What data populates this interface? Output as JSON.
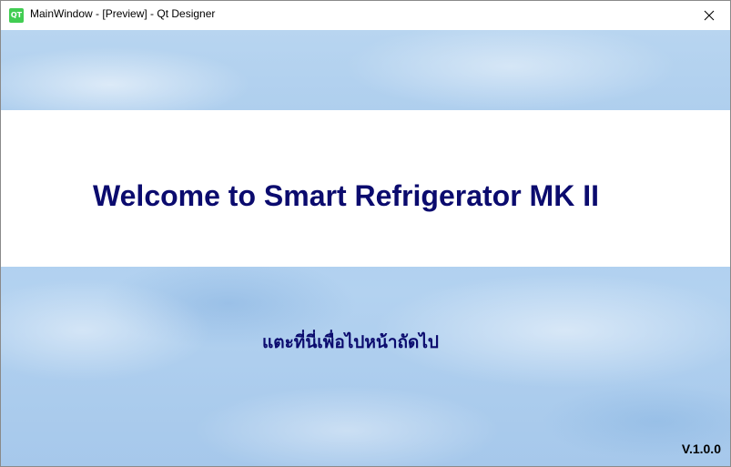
{
  "window": {
    "title": "MainWindow - [Preview] - Qt Designer",
    "app_icon_text": "QT",
    "app_icon_name": "qt-designer-icon",
    "close_icon_name": "close-icon"
  },
  "main": {
    "welcome_text": "Welcome to Smart Refrigerator MK II",
    "tap_next_text": "แตะที่นี่เพื่อไปหน้าถัดไป",
    "version_label": "V.1.0.0"
  },
  "colors": {
    "heading": "#0b0b6e",
    "banner": "#ffffff",
    "sky": "#b3d2f0",
    "qt_green": "#41cd52"
  }
}
